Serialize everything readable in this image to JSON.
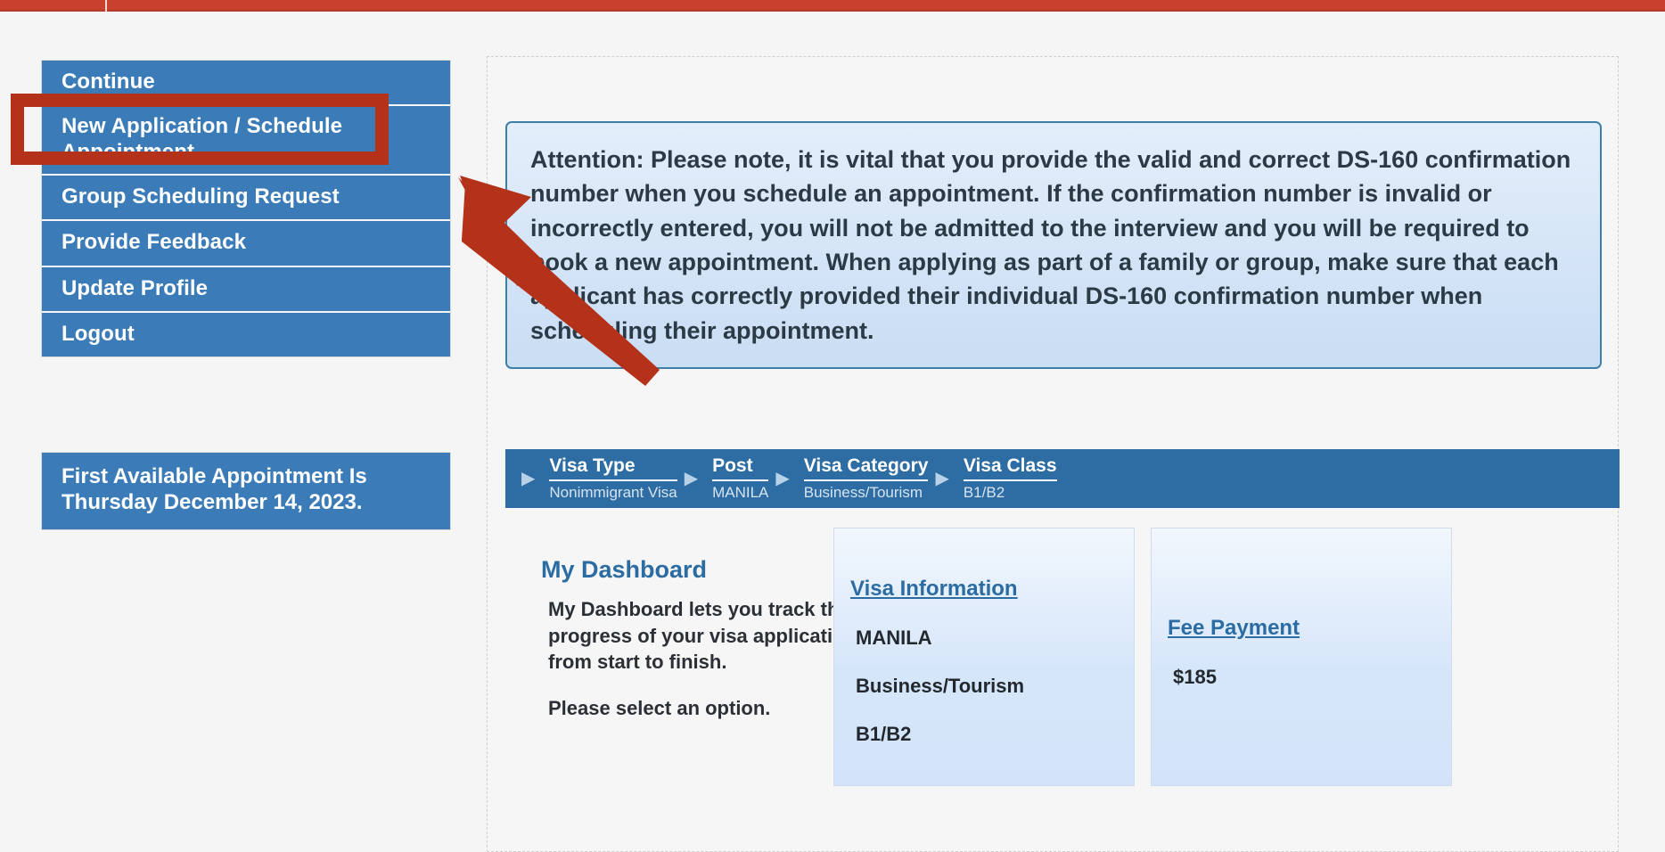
{
  "theme": {
    "top_strip_color": "#c9402f",
    "sidebar_button_color": "#3b7cb8",
    "breadcrumb_color": "#2e6da4",
    "link_color": "#2b6ca3",
    "annotation_color": "#b5321a",
    "attention_border_color": "#3e7fa8"
  },
  "sidebar": {
    "items": [
      {
        "label": "Continue",
        "name": "continue"
      },
      {
        "label": "New Application / Schedule Appointment",
        "name": "new-application-schedule-appointment"
      },
      {
        "label": "Group Scheduling Request",
        "name": "group-scheduling-request"
      },
      {
        "label": "Provide Feedback",
        "name": "provide-feedback"
      },
      {
        "label": "Update Profile",
        "name": "update-profile"
      },
      {
        "label": "Logout",
        "name": "logout"
      }
    ],
    "first_available": "First Available Appointment Is Thursday December 14, 2023."
  },
  "main": {
    "attention": "Attention: Please note, it is vital that you provide the valid and correct DS-160 confirmation number when you schedule an appointment. If the confirmation number is invalid or incorrectly entered, you will not be admitted to the interview and you will be required to book a new appointment. When applying as part of a family or group, make sure that each applicant has correctly provided their individual DS-160 confirmation number when scheduling their appointment.",
    "breadcrumb": [
      {
        "label": "Visa Type",
        "value": "Nonimmigrant Visa"
      },
      {
        "label": "Post",
        "value": "MANILA"
      },
      {
        "label": "Visa Category",
        "value": "Business/Tourism"
      },
      {
        "label": "Visa Class",
        "value": "B1/B2"
      }
    ],
    "breadcrumb_arrow_glyph": "▶",
    "dashboard": {
      "title": "My Dashboard",
      "paragraph1": "My Dashboard lets you track the progress of your visa application from start to finish.",
      "paragraph2": "Please select an option."
    },
    "cards": [
      {
        "name": "visa-information",
        "link": "Visa Information",
        "lines": [
          "MANILA",
          "Business/Tourism",
          "B1/B2"
        ]
      },
      {
        "name": "fee-payment",
        "link": "Fee Payment",
        "lines": [
          "$185"
        ]
      }
    ]
  },
  "annotations": {
    "highlight_box_target": "New Application / Schedule Appointment",
    "arrow_target": "New Application / Schedule Appointment"
  }
}
